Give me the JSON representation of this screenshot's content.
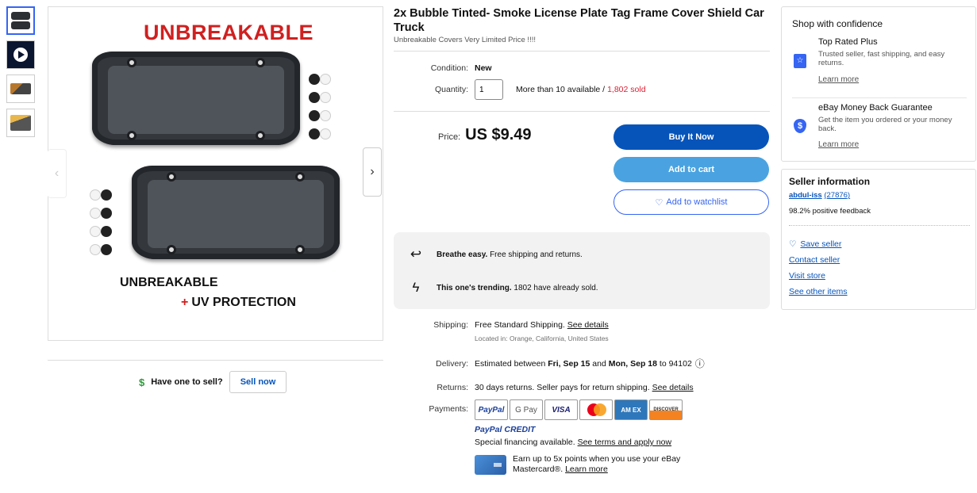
{
  "gallery": {
    "image_title": "UNBREAKABLE",
    "label_line1": "UNBREAKABLE",
    "label_plus": "+",
    "label_line2": "UV PROTECTION",
    "prev_arrow": "‹",
    "next_arrow": "›"
  },
  "sell": {
    "dollar": "$",
    "prompt": "Have one to sell?",
    "button": "Sell now"
  },
  "listing": {
    "title": "2x Bubble Tinted- Smoke License Plate Tag Frame Cover Shield Car Truck",
    "subtitle": "Unbreakable Covers Very Limited Price !!!!",
    "condition_label": "Condition:",
    "condition_value": "New",
    "quantity_label": "Quantity:",
    "quantity_value": "1",
    "availability": "More than 10 available /",
    "sold": "1,802 sold",
    "price_label": "Price:",
    "price": "US $9.49",
    "buy_now": "Buy It Now",
    "add_to_cart": "Add to cart",
    "watch_icon": "♡",
    "add_to_watchlist": "Add to watchlist"
  },
  "highlights": {
    "returns_icon": "↩",
    "returns_bold": "Breathe easy.",
    "returns_text": "Free shipping and returns.",
    "trending_icon": "ϟ",
    "trending_bold": "This one's trending.",
    "trending_text": "1802 have already sold."
  },
  "details": {
    "shipping_label": "Shipping:",
    "shipping_value": "Free Standard Shipping.",
    "shipping_link": "See details",
    "location": "Located in: Orange, California, United States",
    "delivery_label": "Delivery:",
    "delivery_prefix": "Estimated between",
    "delivery_start": "Fri, Sep 15",
    "delivery_and": "and",
    "delivery_end": "Mon, Sep 18",
    "delivery_suffix": "to 94102",
    "info_icon": "ⓘ",
    "returns_label": "Returns:",
    "returns_value": "30 days returns. Seller pays for return shipping.",
    "returns_link": "See details",
    "payments_label": "Payments:",
    "pay_paypal": "PayPal",
    "pay_gpay": "G Pay",
    "pay_visa": "VISA",
    "pay_amex": "AM EX",
    "pay_discover": "DISCOVER",
    "paypal_credit": "PayPal CREDIT",
    "financing_text": "Special financing available.",
    "financing_link": "See terms and apply now",
    "card_text": "Earn up to 5x points when you use your eBay Mastercard®.",
    "card_link": "Learn more"
  },
  "confidence": {
    "title": "Shop with confidence",
    "trp_icon": "☆",
    "trp_title": "Top Rated Plus",
    "trp_desc": "Trusted seller, fast shipping, and easy returns.",
    "trp_link": "Learn more",
    "mbg_icon": "$",
    "mbg_title": "eBay Money Back Guarantee",
    "mbg_desc": "Get the item you ordered or your money back.",
    "mbg_link": "Learn more"
  },
  "seller": {
    "title": "Seller information",
    "name": "abdul-iss",
    "score": "(27876)",
    "feedback": "98.2% positive feedback",
    "save_icon": "♡",
    "save": "Save seller",
    "contact": "Contact seller",
    "visit": "Visit store",
    "other": "See other items"
  }
}
